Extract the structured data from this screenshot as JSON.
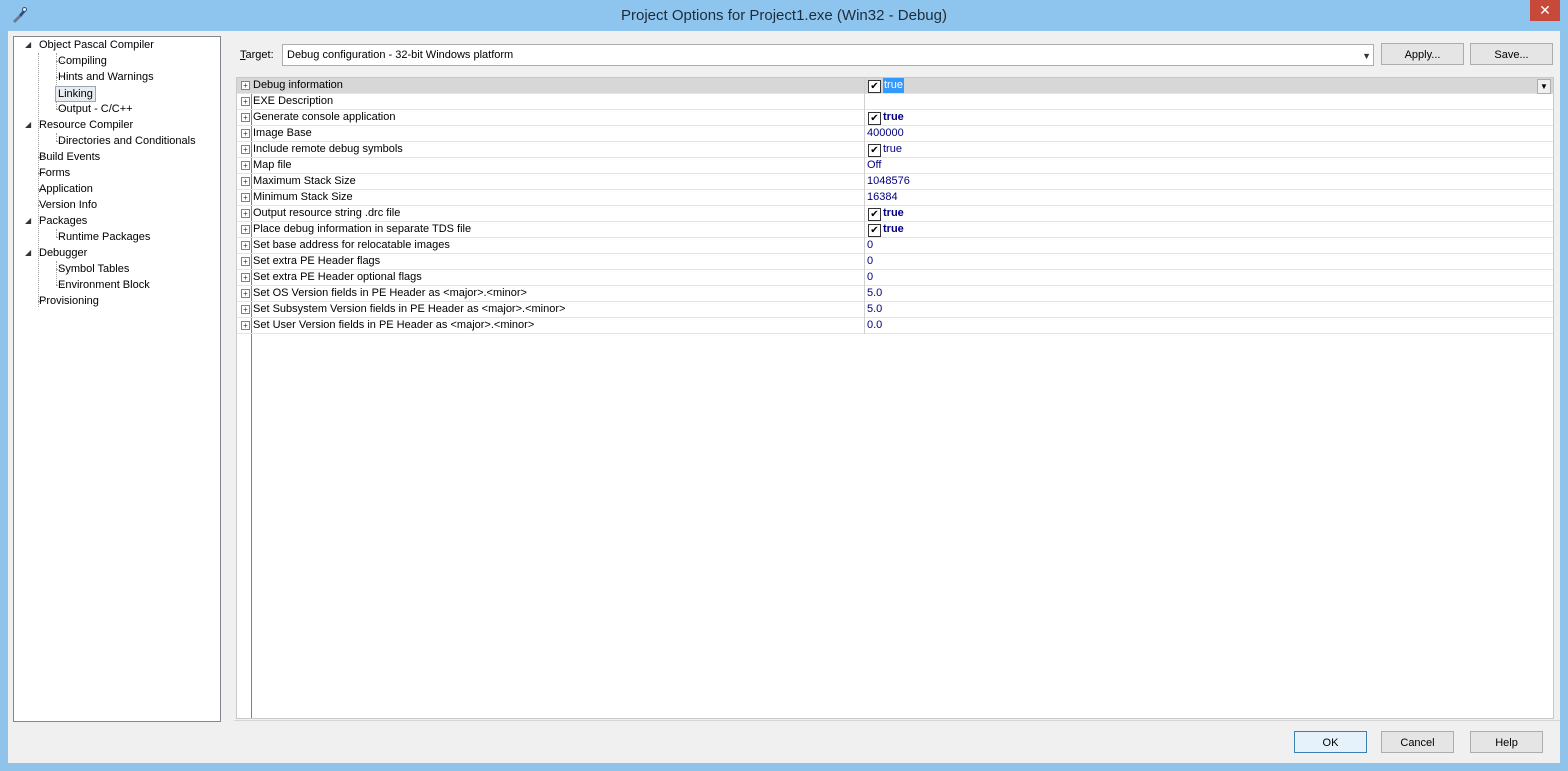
{
  "window": {
    "title": "Project Options for Project1.exe  (Win32 - Debug)",
    "close": "✕"
  },
  "tree": [
    {
      "label": "Object Pascal Compiler"
    },
    {
      "label": "Compiling"
    },
    {
      "label": "Hints and Warnings"
    },
    {
      "label": "Linking"
    },
    {
      "label": "Output - C/C++"
    },
    {
      "label": "Resource Compiler"
    },
    {
      "label": "Directories and Conditionals"
    },
    {
      "label": "Build Events"
    },
    {
      "label": "Forms"
    },
    {
      "label": "Application"
    },
    {
      "label": "Version Info"
    },
    {
      "label": "Packages"
    },
    {
      "label": "Runtime Packages"
    },
    {
      "label": "Debugger"
    },
    {
      "label": "Symbol Tables"
    },
    {
      "label": "Environment Block"
    },
    {
      "label": "Provisioning"
    }
  ],
  "target": {
    "label_underlined": "T",
    "label_rest": "arget:",
    "value": "Debug configuration - 32-bit Windows platform"
  },
  "buttons": {
    "apply": "Apply...",
    "save": "Save...",
    "ok": "OK",
    "cancel": "Cancel",
    "help": "Help"
  },
  "properties": [
    {
      "name": "Debug information",
      "value": "true",
      "checkbox": true,
      "checked": true
    },
    {
      "name": "EXE Description",
      "value": ""
    },
    {
      "name": "Generate console application",
      "value": "true",
      "checkbox": true,
      "checked": true,
      "bold": true
    },
    {
      "name": "Image Base",
      "value": "400000"
    },
    {
      "name": "Include remote debug symbols",
      "value": "true",
      "checkbox": true,
      "checked": true
    },
    {
      "name": "Map file",
      "value": "Off"
    },
    {
      "name": "Maximum Stack Size",
      "value": "1048576"
    },
    {
      "name": "Minimum Stack Size",
      "value": "16384"
    },
    {
      "name": "Output resource string .drc file",
      "value": "true",
      "checkbox": true,
      "checked": true,
      "bold": true
    },
    {
      "name": "Place debug information in separate TDS file",
      "value": "true",
      "checkbox": true,
      "checked": true,
      "bold": true
    },
    {
      "name": "Set base address for relocatable images",
      "value": "0"
    },
    {
      "name": "Set extra PE Header flags",
      "value": "0"
    },
    {
      "name": "Set extra PE Header optional flags",
      "value": "0"
    },
    {
      "name": "Set OS Version fields in PE Header as <major>.<minor>",
      "value": "5.0"
    },
    {
      "name": "Set Subsystem Version fields in PE Header as <major>.<minor>",
      "value": "5.0"
    },
    {
      "name": "Set User Version fields in PE Header as <major>.<minor>",
      "value": "0.0"
    }
  ]
}
